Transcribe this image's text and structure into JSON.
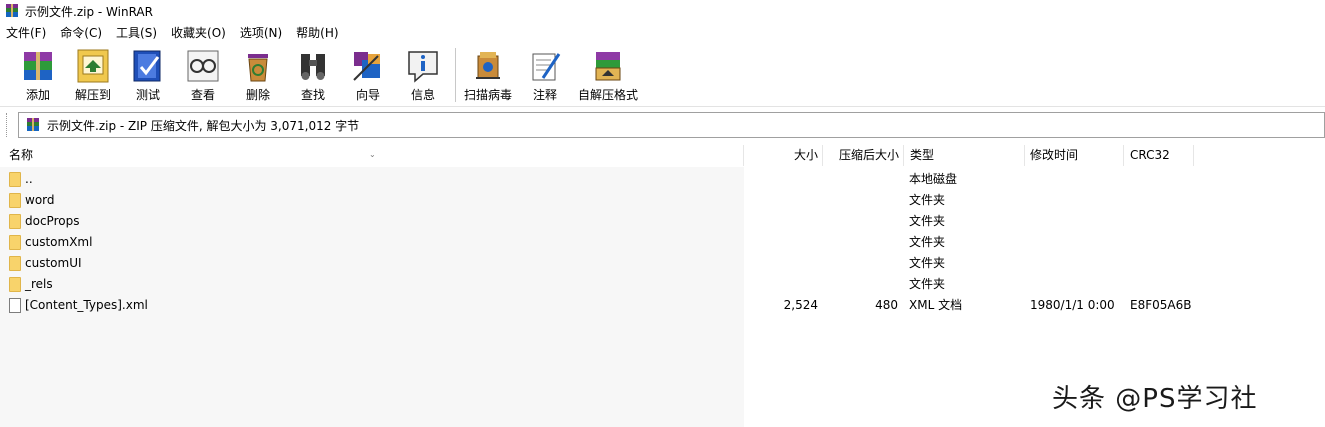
{
  "window": {
    "title": "示例文件.zip - WinRAR"
  },
  "menu": [
    "文件(F)",
    "命令(C)",
    "工具(S)",
    "收藏夹(O)",
    "选项(N)",
    "帮助(H)"
  ],
  "toolbar": {
    "buttons": [
      "添加",
      "解压到",
      "测试",
      "查看",
      "删除",
      "查找",
      "向导",
      "信息",
      "扫描病毒",
      "注释",
      "自解压格式"
    ]
  },
  "address": {
    "text": "示例文件.zip - ZIP 压缩文件, 解包大小为 3,071,012 字节"
  },
  "columns": {
    "name": "名称",
    "size": "大小",
    "packed": "压缩后大小",
    "type": "类型",
    "modified": "修改时间",
    "crc": "CRC32"
  },
  "files": [
    {
      "name": "..",
      "size": "",
      "packed": "",
      "type": "本地磁盘",
      "modified": "",
      "crc": "",
      "icon": "folder-icon"
    },
    {
      "name": "word",
      "size": "",
      "packed": "",
      "type": "文件夹",
      "modified": "",
      "crc": "",
      "icon": "folder-icon"
    },
    {
      "name": "docProps",
      "size": "",
      "packed": "",
      "type": "文件夹",
      "modified": "",
      "crc": "",
      "icon": "folder-icon"
    },
    {
      "name": "customXml",
      "size": "",
      "packed": "",
      "type": "文件夹",
      "modified": "",
      "crc": "",
      "icon": "folder-icon"
    },
    {
      "name": "customUI",
      "size": "",
      "packed": "",
      "type": "文件夹",
      "modified": "",
      "crc": "",
      "icon": "folder-icon"
    },
    {
      "name": "_rels",
      "size": "",
      "packed": "",
      "type": "文件夹",
      "modified": "",
      "crc": "",
      "icon": "folder-icon"
    },
    {
      "name": "[Content_Types].xml",
      "size": "2,524",
      "packed": "480",
      "type": "XML 文档",
      "modified": "1980/1/1 0:00",
      "crc": "E8F05A6B",
      "icon": "document-icon"
    }
  ],
  "watermark": "头条 @PS学习社"
}
